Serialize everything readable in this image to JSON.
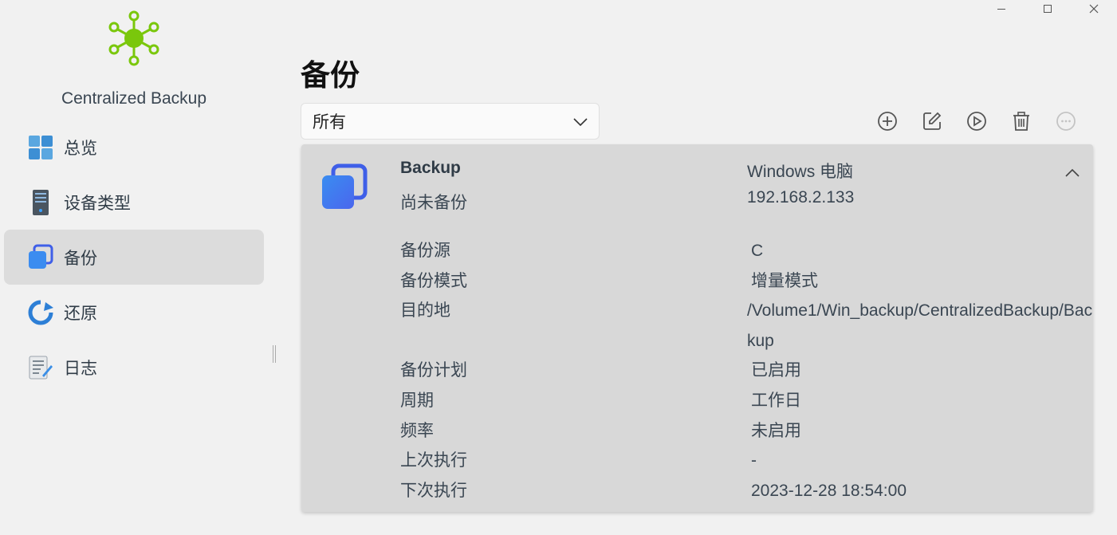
{
  "window": {
    "minimize_icon": "minimize-icon",
    "maximize_icon": "maximize-icon",
    "close_icon": "close-icon"
  },
  "app": {
    "name": "Centralized Backup",
    "logo_color": "#7ac70c"
  },
  "sidebar": {
    "items": [
      {
        "label": "总览",
        "icon": "dashboard-icon"
      },
      {
        "label": "设备类型",
        "icon": "server-icon"
      },
      {
        "label": "备份",
        "icon": "backup-icon",
        "active": true
      },
      {
        "label": "还原",
        "icon": "restore-icon"
      },
      {
        "label": "日志",
        "icon": "log-icon"
      }
    ]
  },
  "main": {
    "title": "备份",
    "filter": {
      "value": "所有"
    },
    "toolbar": [
      "add-icon",
      "edit-icon",
      "play-icon",
      "delete-icon",
      "more-icon"
    ]
  },
  "card": {
    "name": "Backup",
    "status": "尚未备份",
    "device": "Windows 电脑",
    "ip": "192.168.2.133",
    "details": [
      {
        "key": "备份源",
        "value": "C"
      },
      {
        "key": "备份模式",
        "value": "增量模式"
      },
      {
        "key": "目的地",
        "value": "/Volume1/Win_backup/CentralizedBackup/Backup"
      },
      {
        "key": "备份计划",
        "value": "已启用"
      },
      {
        "key": "周期",
        "value": "工作日"
      },
      {
        "key": "频率",
        "value": "未启用"
      },
      {
        "key": "上次执行",
        "value": "-"
      },
      {
        "key": "下次执行",
        "value": "2023-12-28 18:54:00"
      }
    ]
  },
  "colors": {
    "accent_blue": "#3b7ae0",
    "active_bg": "#dcdcdc",
    "card_bg": "#d8d8d8"
  }
}
